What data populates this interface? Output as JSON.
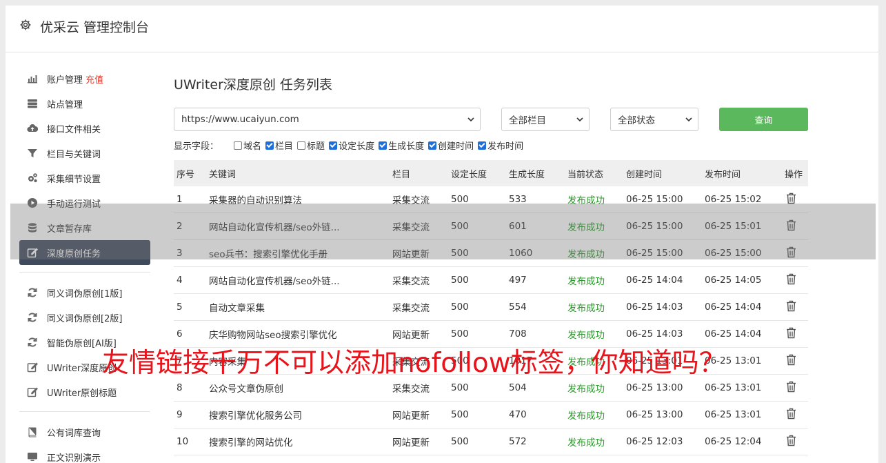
{
  "header": {
    "title": "优采云 管理控制台"
  },
  "sidebar": {
    "group1": [
      {
        "label": "账户管理",
        "extra": "充值",
        "icon": "bar-chart-icon"
      },
      {
        "label": "站点管理",
        "icon": "server-icon"
      },
      {
        "label": "接口文件相关",
        "icon": "cloud-upload-icon"
      },
      {
        "label": "栏目与关键词",
        "icon": "filter-icon"
      },
      {
        "label": "采集细节设置",
        "icon": "gears-icon"
      },
      {
        "label": "手动运行测试",
        "icon": "play-circle-icon"
      },
      {
        "label": "文章暂存库",
        "icon": "database-icon"
      },
      {
        "label": "深度原创任务",
        "icon": "edit-icon",
        "active": true
      }
    ],
    "group2": [
      {
        "label": "同义词伪原创[1版]",
        "icon": "refresh-icon"
      },
      {
        "label": "同义词伪原创[2版]",
        "icon": "refresh-icon"
      },
      {
        "label": "智能伪原创[AI版]",
        "icon": "refresh-icon"
      },
      {
        "label": "UWriter深度原创",
        "icon": "edit-icon"
      },
      {
        "label": "UWriter原创标题",
        "icon": "edit-icon"
      }
    ],
    "group3": [
      {
        "label": "公有词库查询",
        "icon": "book-icon"
      },
      {
        "label": "正文识别演示",
        "icon": "monitor-icon"
      }
    ]
  },
  "main": {
    "title": "UWriter深度原创 任务列表",
    "filters": {
      "site": "https://www.ucaiyun.com",
      "category": "全部栏目",
      "status": "全部状态",
      "query_label": "查询"
    },
    "fields": {
      "label": "显示字段：",
      "items": [
        {
          "label": "域名",
          "checked": false
        },
        {
          "label": "栏目",
          "checked": true
        },
        {
          "label": "标题",
          "checked": false
        },
        {
          "label": "设定长度",
          "checked": true
        },
        {
          "label": "生成长度",
          "checked": true
        },
        {
          "label": "创建时间",
          "checked": true
        },
        {
          "label": "发布时间",
          "checked": true
        }
      ]
    },
    "table": {
      "headers": [
        "序号",
        "关键词",
        "栏目",
        "设定长度",
        "生成长度",
        "当前状态",
        "创建时间",
        "发布时间",
        "操作"
      ],
      "rows": [
        [
          "1",
          "采集器的自动识别算法",
          "采集交流",
          "500",
          "533",
          "发布成功",
          "06-25 15:00",
          "06-25 15:02"
        ],
        [
          "2",
          "网站自动化宣传机器/seo外链...",
          "采集交流",
          "500",
          "601",
          "发布成功",
          "06-25 15:00",
          "06-25 15:01"
        ],
        [
          "3",
          "seo兵书：搜索引擎优化手册",
          "网站更新",
          "500",
          "1060",
          "发布成功",
          "06-25 15:00",
          "06-25 15:00"
        ],
        [
          "4",
          "网站自动化宣传机器/seo外链...",
          "采集交流",
          "500",
          "497",
          "发布成功",
          "06-25 14:04",
          "06-25 14:05"
        ],
        [
          "5",
          "自动文章采集",
          "采集交流",
          "500",
          "554",
          "发布成功",
          "06-25 14:03",
          "06-25 14:04"
        ],
        [
          "6",
          "庆华购物网站seo搜索引擎优化",
          "网站更新",
          "500",
          "708",
          "发布成功",
          "06-25 14:03",
          "06-25 14:04"
        ],
        [
          "7",
          "内容采集",
          "采集交流",
          "500",
          "1017",
          "发布成功",
          "06-25 13:01",
          "06-25 13:01"
        ],
        [
          "8",
          "公众号文章伪原创",
          "采集交流",
          "500",
          "504",
          "发布成功",
          "06-25 13:00",
          "06-25 13:01"
        ],
        [
          "9",
          "搜索引擎优化服务公司",
          "网站更新",
          "500",
          "470",
          "发布成功",
          "06-25 13:00",
          "06-25 13:01"
        ],
        [
          "10",
          "搜索引擎的网站优化",
          "网站更新",
          "500",
          "572",
          "发布成功",
          "06-25 12:03",
          "06-25 12:04"
        ]
      ]
    }
  },
  "overlay": {
    "caption": "友情链接千万不可以添加nofollow标签，你知道吗？"
  },
  "colors": {
    "accent": "#5cb85c",
    "active_nav": "#3f4a5d",
    "success": "#2a9a2a",
    "caption": "#e8141b",
    "recharge": "#e63c2f"
  }
}
